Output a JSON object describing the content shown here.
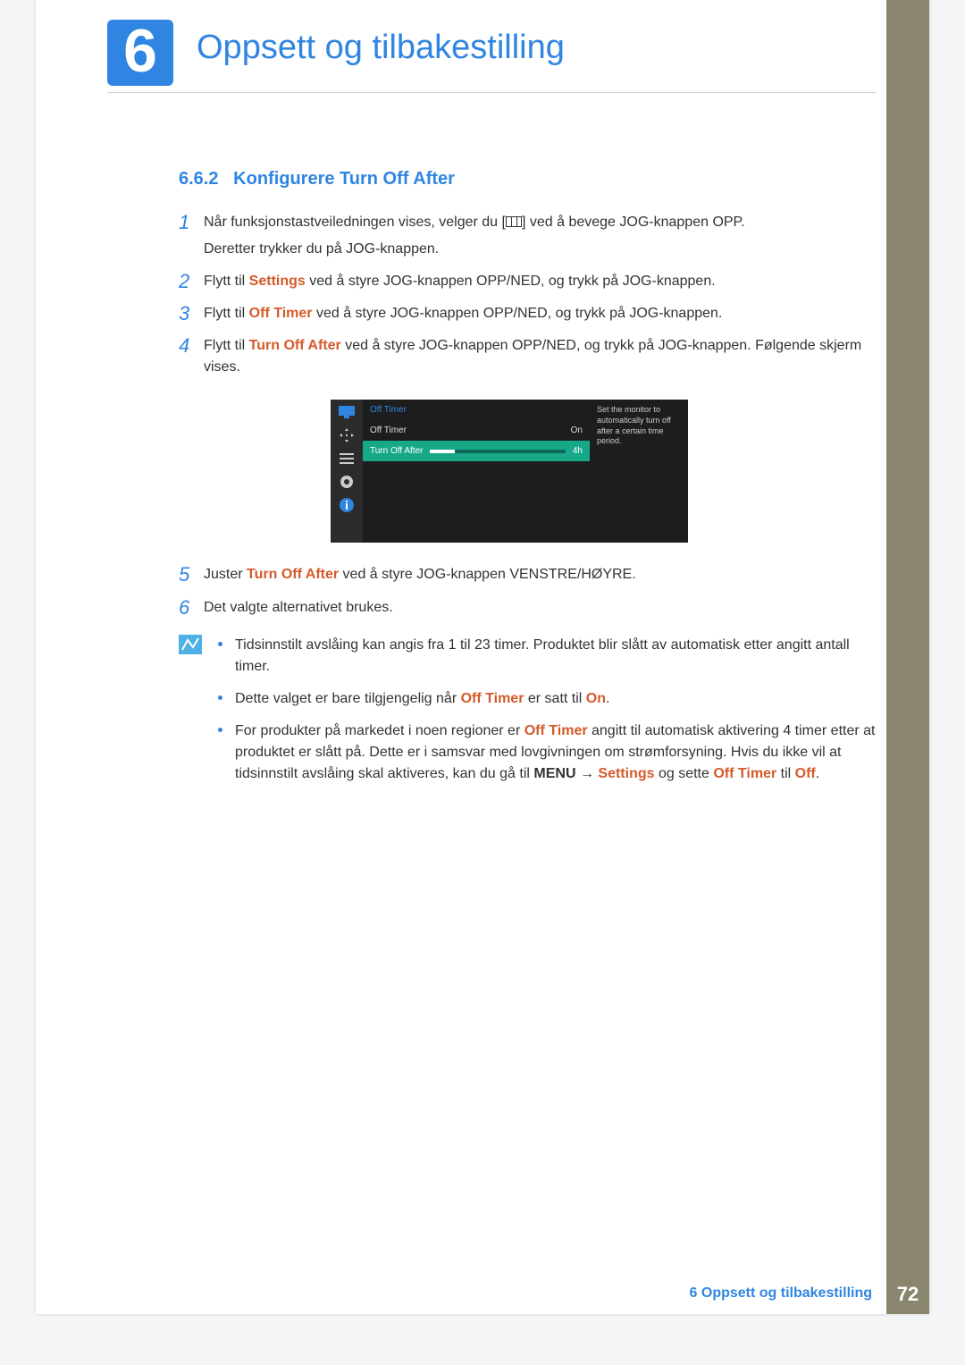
{
  "chapter": {
    "number": "6",
    "title": "Oppsett og tilbakestilling"
  },
  "section": {
    "number": "6.6.2",
    "title": "Konfigurere Turn Off After"
  },
  "steps": [
    {
      "num": "1",
      "pre": "Når funksjonstastveiledningen vises, velger du [",
      "post": "] ved å bevege JOG-knappen OPP.",
      "line2": "Deretter trykker du på JOG-knappen."
    },
    {
      "num": "2",
      "pre": "Flytt til ",
      "hl": "Settings",
      "post": " ved å styre JOG-knappen OPP/NED, og trykk på JOG-knappen."
    },
    {
      "num": "3",
      "pre": "Flytt til ",
      "hl": "Off Timer",
      "post": " ved å styre JOG-knappen OPP/NED, og trykk på JOG-knappen."
    },
    {
      "num": "4",
      "pre": "Flytt til ",
      "hl": "Turn Off After",
      "post": " ved å styre JOG-knappen OPP/NED, og trykk på JOG-knappen. Følgende skjerm vises."
    },
    {
      "num": "5",
      "pre": "Juster ",
      "hl": "Turn Off After",
      "post": " ved å styre JOG-knappen VENSTRE/HØYRE."
    },
    {
      "num": "6",
      "plain": "Det valgte alternativet brukes."
    }
  ],
  "osd": {
    "header": "Off Timer",
    "row1_label": "Off Timer",
    "row1_value": "On",
    "row2_label": "Turn Off After",
    "row2_value": "4h",
    "desc": "Set the monitor to automatically turn off after a certain time period."
  },
  "notes": [
    {
      "text": "Tidsinnstilt avslåing kan angis fra 1 til 23 timer. Produktet blir slått av automatisk etter angitt antall timer."
    },
    {
      "pre": "Dette valget er bare tilgjengelig når ",
      "hl1": "Off Timer",
      "mid": " er satt til ",
      "hl2": "On",
      "post": "."
    },
    {
      "pre": "For produkter på markedet i noen regioner er ",
      "hl1": "Off Timer",
      "mid1": " angitt til automatisk aktivering 4 timer etter at produktet er slått på. Dette er i samsvar med lovgivningen om strømforsyning. Hvis du ikke vil at tidsinnstilt avslåing skal aktiveres, kan du gå til ",
      "menu": "MENU",
      "arrow": " → ",
      "hl2": "Settings",
      "mid2": " og sette ",
      "hl3": "Off Timer",
      "mid3": " til ",
      "hl4": "Off",
      "post": "."
    }
  ],
  "footer": {
    "text": "6 Oppsett og tilbakestilling",
    "page": "72"
  }
}
